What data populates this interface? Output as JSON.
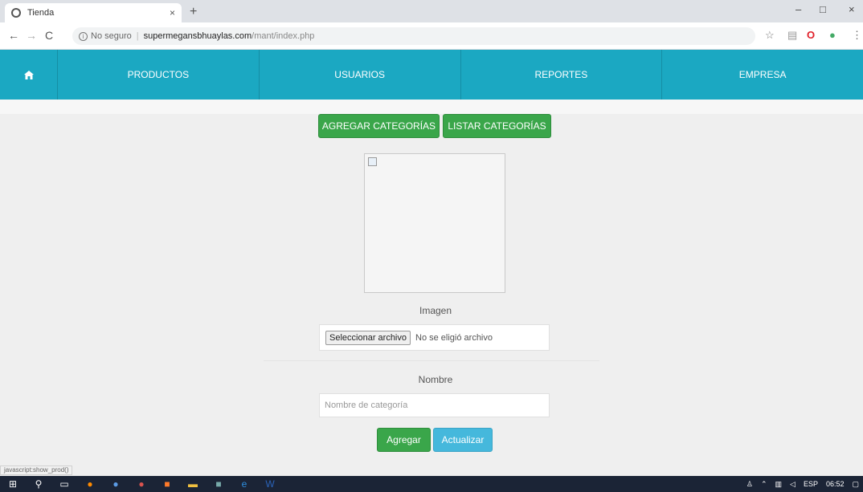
{
  "browser": {
    "tab_title": "Tienda",
    "tab_close": "×",
    "new_tab": "+",
    "security_label": "No seguro",
    "url_host": "supermegansbhuaylas.com",
    "url_path": "/mant/index.php",
    "window_min": "–",
    "window_max": "□",
    "window_close": "×",
    "back": "←",
    "forward": "→",
    "reload": "C",
    "status_text": "javascript:show_prod()"
  },
  "nav": {
    "home_icon": "home-icon",
    "items": [
      "PRODUCTOS",
      "USUARIOS",
      "REPORTES",
      "EMPRESA"
    ],
    "color": "#1ba8c2"
  },
  "actions": {
    "add_category": "AGREGAR CATEGORÍAS",
    "list_categories": "LISTAR CATEGORÍAS"
  },
  "form": {
    "image_label": "Imagen",
    "file_button": "Seleccionar archivo",
    "file_status": "No se eligió archivo",
    "name_label": "Nombre",
    "name_placeholder": "Nombre de categoría",
    "name_value": "",
    "add_button": "Agregar",
    "update_button": "Actualizar"
  },
  "colors": {
    "green": "#3aa64a",
    "blue": "#45b8dc",
    "taskbar": "#1b2436"
  },
  "taskbar": {
    "language": "ESP",
    "time": "06:52"
  }
}
